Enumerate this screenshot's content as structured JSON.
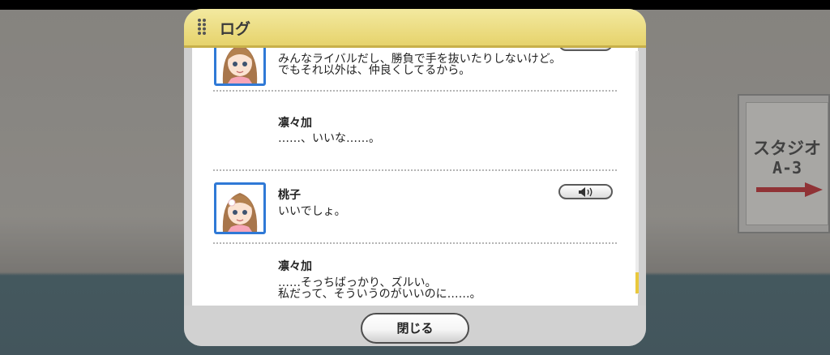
{
  "background": {
    "sign": {
      "line1": "スタジオ",
      "line2": "A-3"
    }
  },
  "dialog": {
    "title": "ログ",
    "entries": [
      {
        "speaker": "",
        "avatar": "momoko-portrait",
        "message": "みんなライバルだし、勝負で手を抜いたりしないけど。\nでもそれ以外は、仲良くしてるから。",
        "has_voice": true
      },
      {
        "speaker": "凛々加",
        "avatar": "",
        "message": "……、いいな……。",
        "has_voice": false
      },
      {
        "speaker": "桃子",
        "avatar": "momoko-portrait",
        "message": "いいでしょ。",
        "has_voice": true
      },
      {
        "speaker": "凛々加",
        "avatar": "",
        "message": "……そっちばっかり、ズルい。\n私だって、そういうのがいいのに……。",
        "has_voice": false
      }
    ],
    "voice_icon": "speaker-icon",
    "close_label": "閉じる"
  },
  "colors": {
    "header": "#e6d36c",
    "avatar_border": "#2f79d6",
    "scroll_thumb": "#e9c83c",
    "sign_arrow": "#c8474c"
  }
}
